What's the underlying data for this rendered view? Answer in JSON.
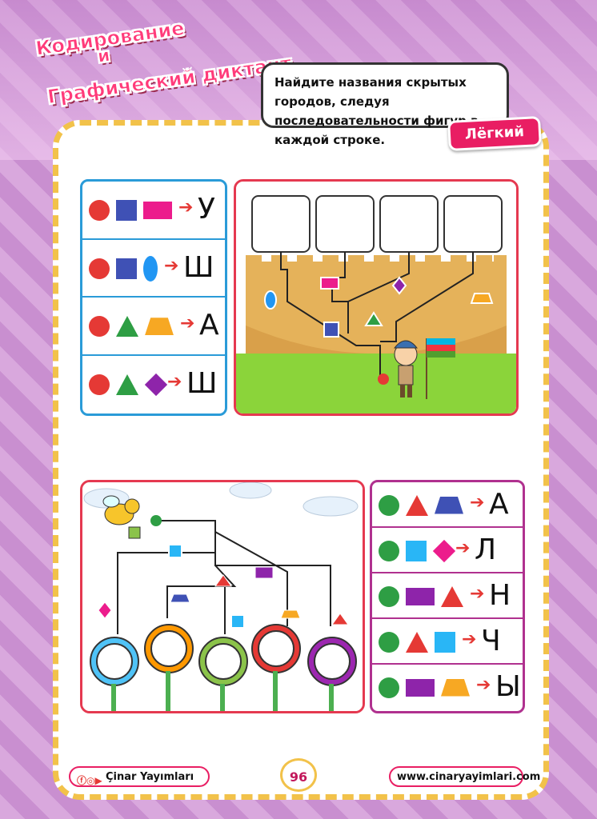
{
  "header": {
    "title_line1": "Кодирование",
    "title_line2": "и",
    "title_line3": "Графический диктант",
    "instruction": "Найдите названия скрытых городов, следуя последовательности фигур в каждой строке.",
    "level": "Лёгкий"
  },
  "puzzle1": {
    "rows": [
      {
        "shapes": [
          "red-circle",
          "blue-square",
          "pink-rectangle"
        ],
        "letter": "У"
      },
      {
        "shapes": [
          "red-circle",
          "blue-square",
          "blue-oval"
        ],
        "letter": "Ш"
      },
      {
        "shapes": [
          "red-circle",
          "green-triangle",
          "orange-trapezoid"
        ],
        "letter": "А"
      },
      {
        "shapes": [
          "red-circle",
          "green-triangle",
          "purple-diamond"
        ],
        "letter": "Ш"
      }
    ],
    "answer_boxes": 4
  },
  "puzzle2": {
    "rows": [
      {
        "shapes": [
          "green-circle",
          "red-triangle",
          "blue-trapezoid"
        ],
        "letter": "А"
      },
      {
        "shapes": [
          "green-circle",
          "cyan-square",
          "pink-diamond"
        ],
        "letter": "Л"
      },
      {
        "shapes": [
          "green-circle",
          "purple-rectangle",
          "red-triangle"
        ],
        "letter": "Н"
      },
      {
        "shapes": [
          "green-circle",
          "red-triangle",
          "cyan-square"
        ],
        "letter": "Ч"
      },
      {
        "shapes": [
          "green-circle",
          "purple-rectangle",
          "orange-trapezoid"
        ],
        "letter": "Ы"
      }
    ],
    "answer_circles": 5
  },
  "footer": {
    "publisher": "Çinar Yayımları",
    "page": "96",
    "website": "www.cinaryayimlari.com"
  },
  "colors": {
    "red": "#e53935",
    "blue": "#3f51b5",
    "pink": "#ec1c8c",
    "oval": "#2196f3",
    "green": "#2e9e44",
    "orange": "#f7a823",
    "purple": "#8e24aa",
    "cyan": "#29b6f6",
    "border_blue": "#2a9bd8",
    "border_purple": "#b0318f"
  }
}
